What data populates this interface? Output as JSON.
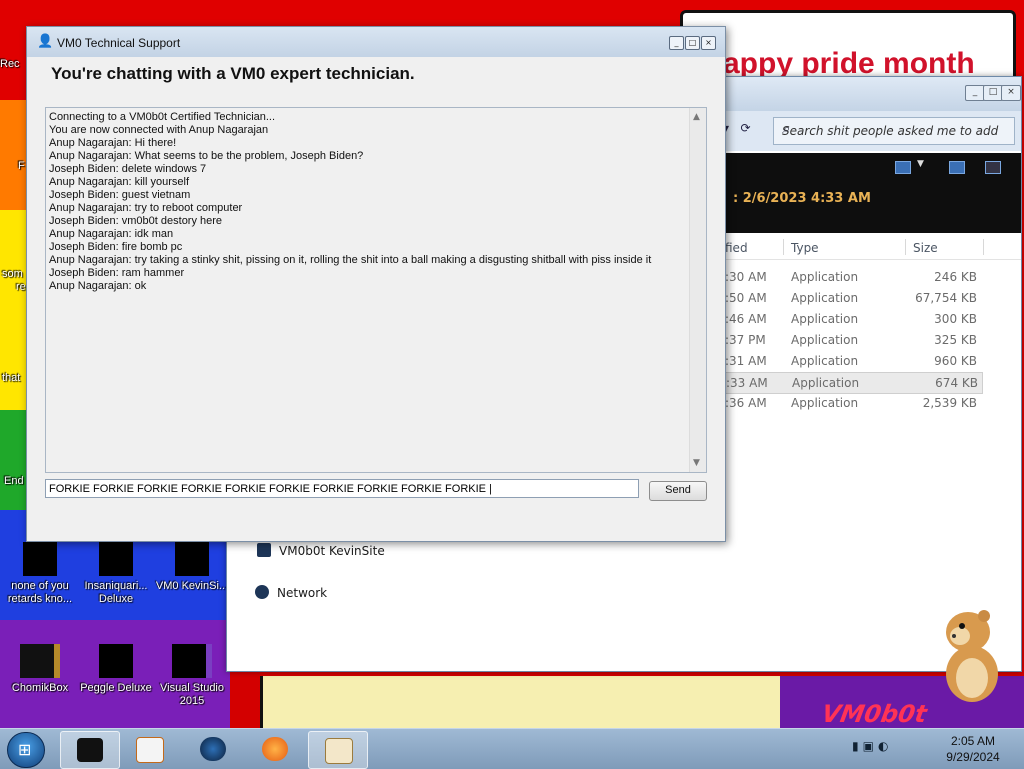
{
  "wallpaper": {
    "banner": "appy pride month",
    "watermark": "VM0b0t"
  },
  "desktop_icons": [
    {
      "label": "Rec"
    },
    {
      "label": "none of you retards kno..."
    },
    {
      "label": "Insaniquari... Deluxe"
    },
    {
      "label": "VM0 KevinSi..."
    },
    {
      "label": "ChomikBox"
    },
    {
      "label": "Peggle Deluxe"
    },
    {
      "label": "Visual Studio 2015"
    }
  ],
  "desktop_partial_labels": [
    "F",
    "som",
    "re",
    "that",
    "End"
  ],
  "explorer": {
    "search_placeholder": "Search shit people asked me to add",
    "date_text": ": 2/6/2023 4:33 AM",
    "columns": {
      "modified": "fied",
      "type": "Type",
      "size": "Size"
    },
    "rows": [
      {
        "time": ":30 AM",
        "type": "Application",
        "size": "246 KB"
      },
      {
        "time": ":50 AM",
        "type": "Application",
        "size": "67,754 KB"
      },
      {
        "time": ":46 AM",
        "type": "Application",
        "size": "300 KB"
      },
      {
        "time": ":37 PM",
        "type": "Application",
        "size": "325 KB"
      },
      {
        "time": ":31 AM",
        "type": "Application",
        "size": "960 KB"
      },
      {
        "time": ":33 AM",
        "type": "Application",
        "size": "674 KB",
        "selected": true
      },
      {
        "time": ":36 AM",
        "type": "Application",
        "size": "2,539 KB"
      }
    ],
    "nav_items": [
      "VM0b0t KevinSite",
      "Network"
    ]
  },
  "chat": {
    "title": "VM0 Technical Support",
    "heading": "You're chatting with a VM0 expert technician.",
    "messages": [
      "Connecting to a VM0b0t Certified Technician...",
      "You are now connected with Anup Nagarajan",
      "Anup Nagarajan: Hi there!",
      "Anup Nagarajan: What seems to be the problem, Joseph Biden?",
      "Joseph Biden: delete windows 7",
      "Anup Nagarajan: kill yourself",
      "Joseph Biden: guest vietnam",
      "Anup Nagarajan: try to reboot computer",
      "Joseph Biden: vm0b0t destory here",
      "Anup Nagarajan: idk man",
      "Joseph Biden: fire bomb pc",
      "Anup Nagarajan: try taking a stinky shit, pissing on it, rolling the shit into a ball making a disgusting shitball with piss inside it",
      "Joseph Biden: ram hammer",
      "Anup Nagarajan: ok"
    ],
    "input_value": "FORKIE FORKIE FORKIE FORKIE FORKIE FORKIE FORKIE FORKIE FORKIE FORKIE |",
    "send_label": "Send"
  },
  "taskbar": {
    "clock_time": "2:05 AM",
    "clock_date": "9/29/2024"
  },
  "colors": {
    "desktop_red": "#e00000",
    "chat_bg": "#f0f0f0",
    "taskbar": "#8faac6",
    "accent_date": "#e9b255"
  }
}
